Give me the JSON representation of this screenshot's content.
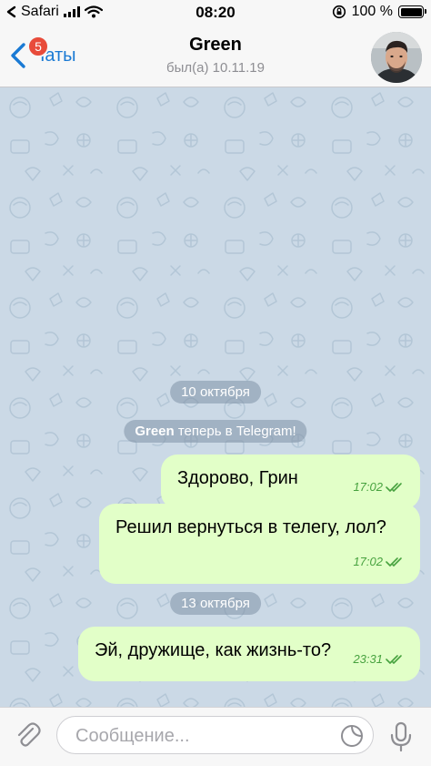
{
  "status_bar": {
    "carrier": "Safari",
    "time": "08:20",
    "battery": "100 %",
    "battery_level": 1.0
  },
  "header": {
    "back_label": "Чаты",
    "unread_badge": "5",
    "title": "Green",
    "subtitle": "был(а) 10.11.19"
  },
  "messages": {
    "date1": "10 октября",
    "service_name": "Green",
    "service_text": " теперь в Telegram!",
    "msg1_text": "Здорово, Грин",
    "msg1_time": "17:02",
    "msg2_text": "Решил вернуться в телегу, лол?",
    "msg2_time": "17:02",
    "date2": "13 октября",
    "msg3_text": "Эй, дружище, как жизнь-то?",
    "msg3_time": "23:31"
  },
  "input": {
    "placeholder": "Сообщение..."
  },
  "colors": {
    "accent": "#1a7ad4",
    "badge": "#e84b3a",
    "bubble_out": "#e2ffc8",
    "time_out": "#47a23f",
    "chat_bg": "#cbd9e6"
  },
  "icons": [
    "wifi-icon",
    "signal-icon",
    "orientation-lock-icon",
    "battery-icon",
    "back-chevron-icon",
    "double-check-icon",
    "paperclip-icon",
    "sticker-icon",
    "microphone-icon"
  ]
}
